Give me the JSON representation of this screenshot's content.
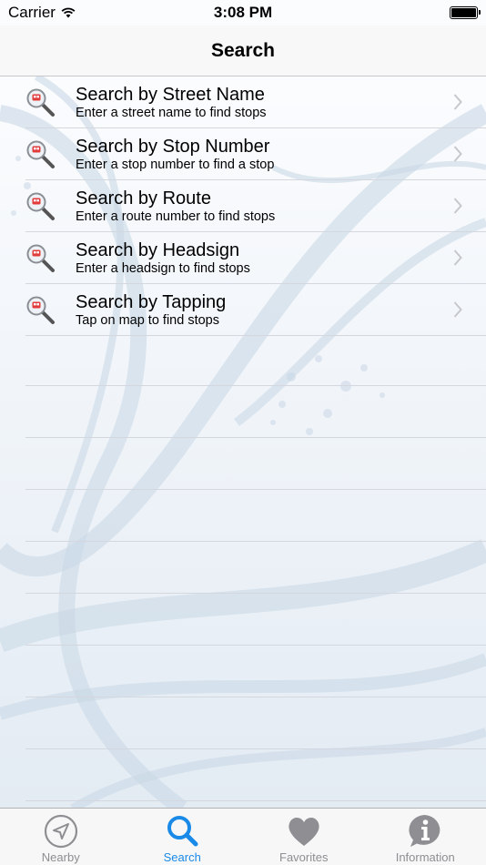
{
  "status_bar": {
    "carrier": "Carrier",
    "time": "3:08 PM"
  },
  "nav": {
    "title": "Search"
  },
  "rows": [
    {
      "title": "Search by Street Name",
      "subtitle": "Enter a street name to find stops"
    },
    {
      "title": "Search by Stop Number",
      "subtitle": "Enter a stop number to find a stop"
    },
    {
      "title": "Search by Route",
      "subtitle": "Enter a route number to find stops"
    },
    {
      "title": "Search by Headsign",
      "subtitle": "Enter a headsign to find stops"
    },
    {
      "title": "Search by Tapping",
      "subtitle": "Tap on map to find stops"
    }
  ],
  "tabs": [
    {
      "label": "Nearby",
      "icon": "navigation-arrow-icon"
    },
    {
      "label": "Search",
      "icon": "magnifier-icon",
      "active": true
    },
    {
      "label": "Favorites",
      "icon": "heart-icon"
    },
    {
      "label": "Information",
      "icon": "info-bubble-icon"
    }
  ],
  "colors": {
    "active_tab": "#1a8ae8",
    "inactive_tab": "#8e8e93"
  }
}
